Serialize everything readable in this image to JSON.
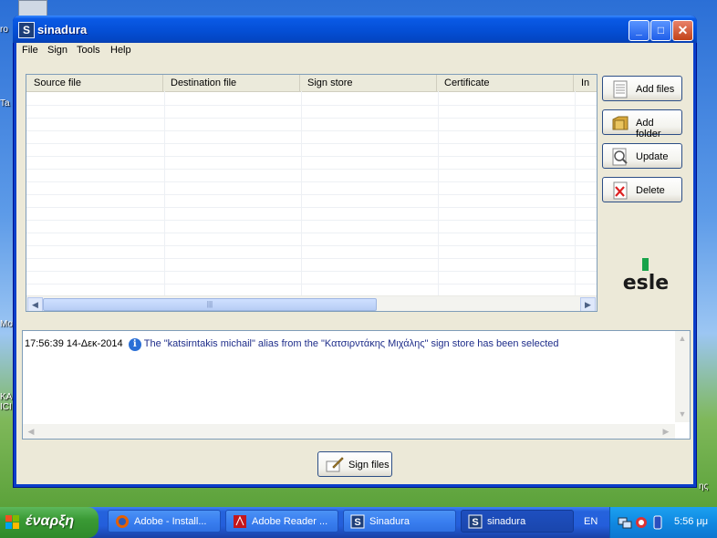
{
  "window": {
    "title": "sinadura",
    "min_symbol": "_",
    "max_symbol": "□",
    "close_symbol": "✕"
  },
  "menu": [
    "File",
    "Sign",
    "Tools",
    "Help"
  ],
  "table": {
    "columns": [
      "Source file",
      "Destination file",
      "Sign store",
      "Certificate",
      "In"
    ]
  },
  "side_buttons": {
    "add_files": "Add files",
    "add_folder": "Add folder",
    "update": "Update",
    "delete": "Delete"
  },
  "logo": {
    "text": "esle"
  },
  "log": {
    "timestamp": "17:56:39 14-Δεκ-2014",
    "message": "The \"katsirntakis michail\" alias from the \"Κατσιρντάκης Μιχάλης\" sign store has been selected"
  },
  "sign_button": "Sign files",
  "taskbar": {
    "start_label": "έναρξη",
    "tasks": [
      {
        "label": "Adobe - Install...",
        "icon": "firefox-icon",
        "active": false
      },
      {
        "label": "Adobe Reader ...",
        "icon": "adobe-reader-icon",
        "active": false
      },
      {
        "label": "Sinadura",
        "icon": "sinadura-icon",
        "active": false
      },
      {
        "label": "sinadura",
        "icon": "sinadura-icon",
        "active": true
      }
    ],
    "language": "EN",
    "clock": "5:56 μμ"
  },
  "colors": {
    "accent": "#0550d8",
    "log_text": "#1e2d8a",
    "logo_green": "#17a34a"
  }
}
